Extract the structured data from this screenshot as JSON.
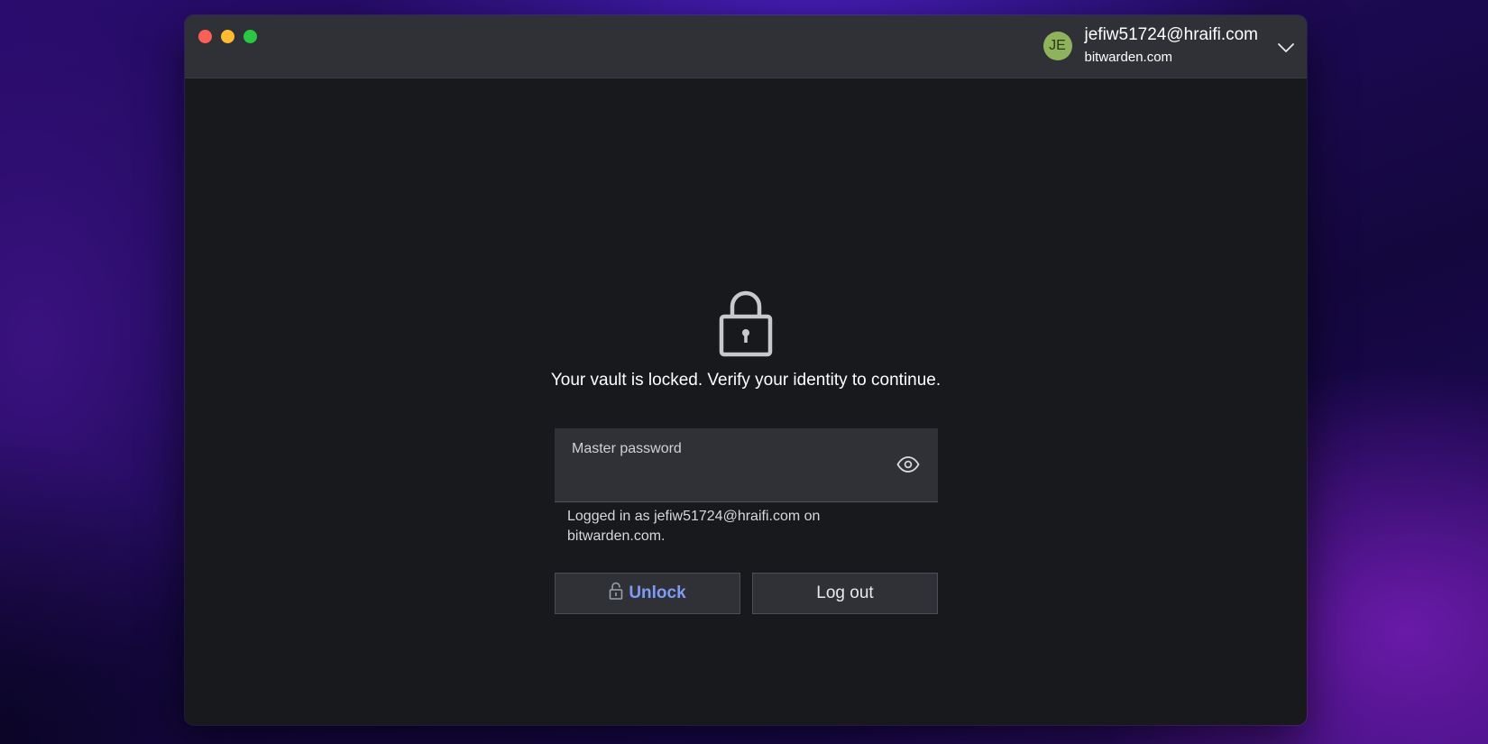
{
  "account": {
    "initials": "JE",
    "email": "jefiw51724@hraifi.com",
    "server": "bitwarden.com"
  },
  "lock_screen": {
    "message": "Your vault is locked. Verify your identity to continue.",
    "password_label": "Master password",
    "password_value": "",
    "logged_in_text": "Logged in as jefiw51724@hraifi.com on bitwarden.com.",
    "unlock_label": "Unlock",
    "logout_label": "Log out"
  },
  "icons": {
    "lock": "lock-icon",
    "eye": "eye-icon",
    "unlock": "unlock-icon",
    "chevron": "chevron-down-icon"
  },
  "colors": {
    "accent": "#7f9cf5",
    "avatar": "#8fb35c",
    "window_bg": "#17191d",
    "titlebar_bg": "#2f3136"
  }
}
